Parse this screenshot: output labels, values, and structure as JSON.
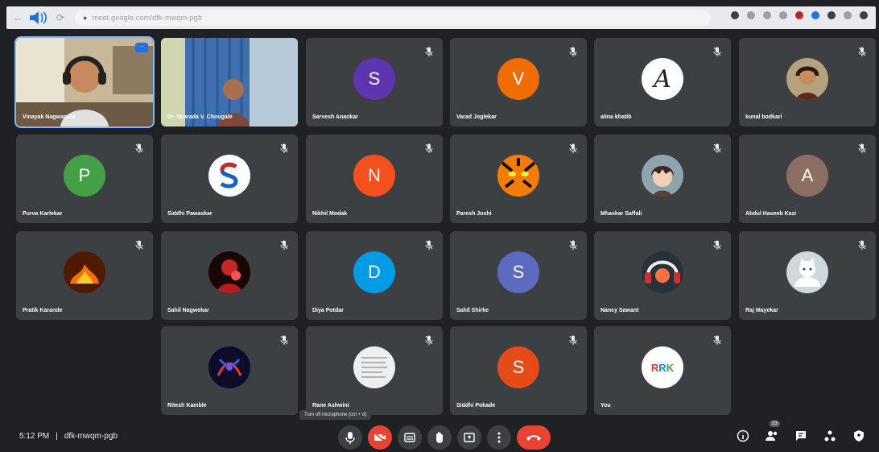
{
  "browser": {
    "url": "meet.google.com/dfk-mwqm-pgb"
  },
  "participants": [
    {
      "name": "Vinayak Nagwanshi",
      "type": "video",
      "scene": "boy-headphones",
      "active": true
    },
    {
      "name": "Dr. Sharada V. Chougale",
      "type": "video",
      "scene": "curtain-room"
    },
    {
      "name": "Sarvesh Anaokar",
      "type": "letter",
      "letter": "S",
      "color": "#5e35b1"
    },
    {
      "name": "Varad Joglekar",
      "type": "letter",
      "letter": "V",
      "color": "#ef6c00"
    },
    {
      "name": "alina khatib",
      "type": "letter",
      "letter": "A",
      "color": "#ffffff",
      "fg": "#202124",
      "script": true
    },
    {
      "name": "kunal bodkari",
      "type": "image",
      "image": "portrait"
    },
    {
      "name": "Purva Karlekar",
      "type": "letter",
      "letter": "P",
      "color": "#43a047"
    },
    {
      "name": "Siddhi Pawaskar",
      "type": "image",
      "image": "logo-s"
    },
    {
      "name": "Nikhil Modak",
      "type": "letter",
      "letter": "N",
      "color": "#f4511e"
    },
    {
      "name": "Paresh Joshi",
      "type": "image",
      "image": "tiger"
    },
    {
      "name": "Mhaskar Saffali",
      "type": "image",
      "image": "anime"
    },
    {
      "name": "Abdul Haseeb Kazi",
      "type": "letter",
      "letter": "A",
      "color": "#8d6e63"
    },
    {
      "name": "Pratik Karande",
      "type": "image",
      "image": "fire"
    },
    {
      "name": "Sahil Nagwekar",
      "type": "image",
      "image": "red-figure"
    },
    {
      "name": "Diya Potdar",
      "type": "letter",
      "letter": "D",
      "color": "#039be5"
    },
    {
      "name": "Sahil Shirke",
      "type": "letter",
      "letter": "S",
      "color": "#5c6bc0"
    },
    {
      "name": "Nancy Sawant",
      "type": "image",
      "image": "dj"
    },
    {
      "name": "Raj Mayekar",
      "type": "image",
      "image": "cat"
    },
    {
      "name": "Ritesh Kamble",
      "type": "image",
      "image": "neon"
    },
    {
      "name": "Rane Ashwini",
      "type": "image",
      "image": "paper"
    },
    {
      "name": "Siddhi Pokade",
      "type": "letter",
      "letter": "S",
      "color": "#e64a19"
    },
    {
      "name": "You",
      "type": "image",
      "image": "rrk",
      "label": "RRK"
    }
  ],
  "footer": {
    "time": "5:12 PM",
    "separator": "|",
    "meeting_code": "dfk-mwqm-pgb",
    "tooltip": "Turn off microphone (ctrl + d)",
    "participant_count": "23"
  }
}
